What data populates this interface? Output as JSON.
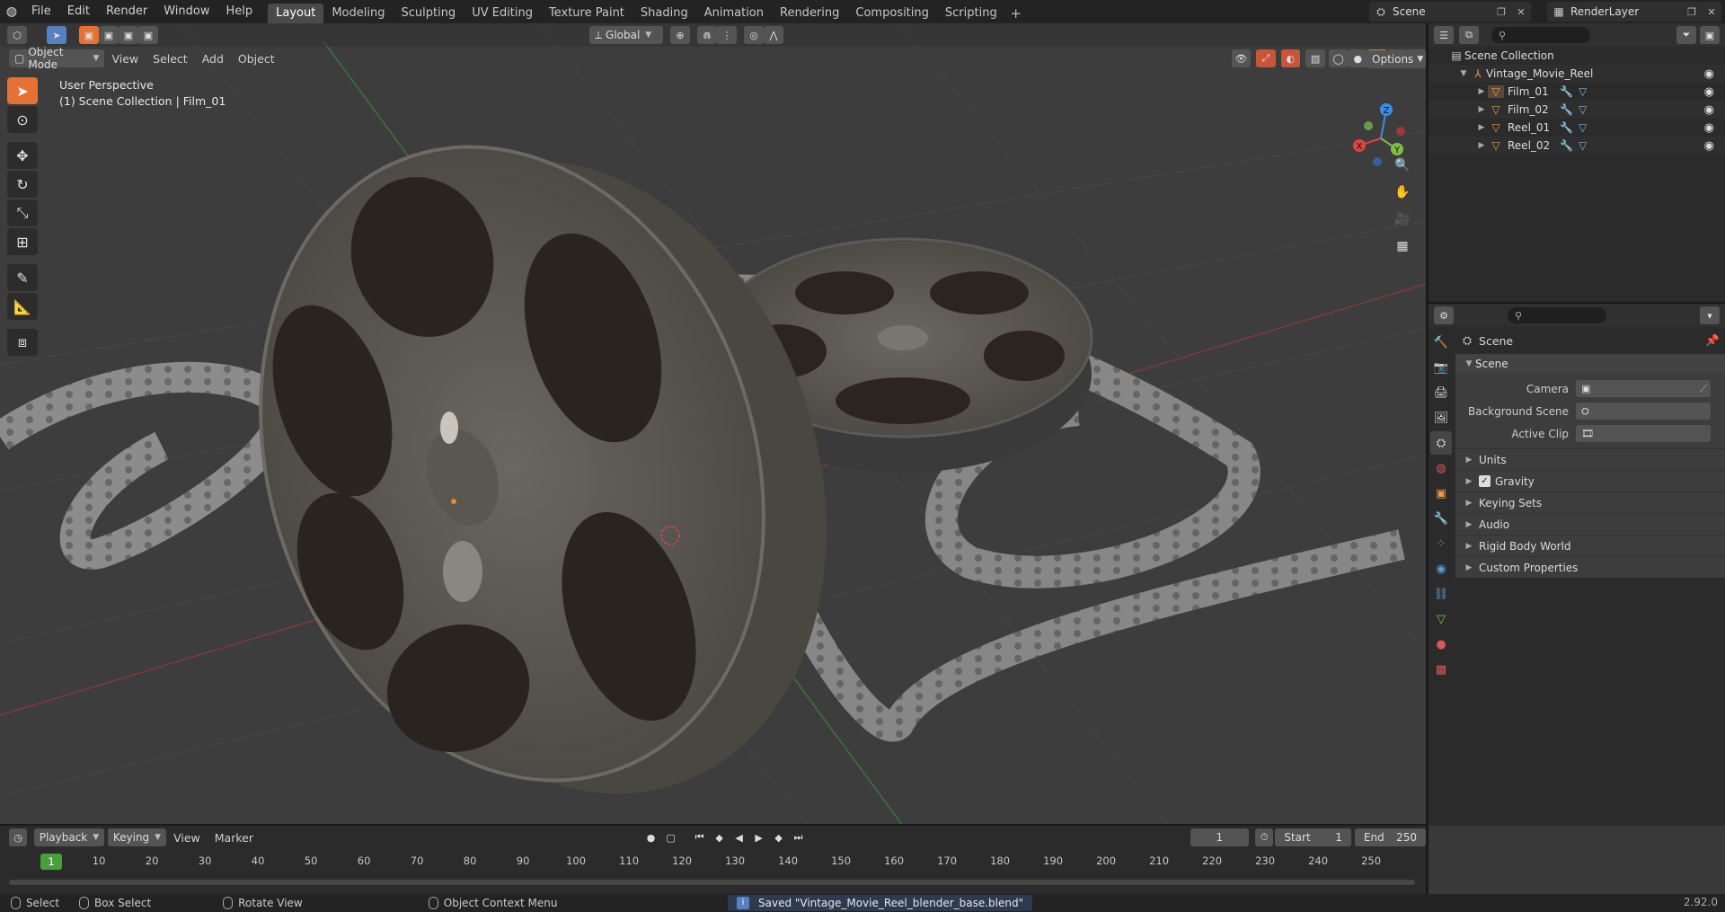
{
  "menubar": {
    "items": [
      "File",
      "Edit",
      "Render",
      "Window",
      "Help"
    ],
    "workspaces": [
      "Layout",
      "Modeling",
      "Sculpting",
      "UV Editing",
      "Texture Paint",
      "Shading",
      "Animation",
      "Rendering",
      "Compositing",
      "Scripting"
    ],
    "active_workspace": "Layout",
    "scene_name": "Scene",
    "view_layer": "RenderLayer"
  },
  "viewport": {
    "mode": "Object Mode",
    "menus": [
      "View",
      "Select",
      "Add",
      "Object"
    ],
    "transform_orientation": "Global",
    "options_label": "Options",
    "perspective_label": "User Perspective",
    "collection_label": "(1) Scene Collection | Film_01",
    "gizmo": {
      "x": "X",
      "y": "Y",
      "z": "Z"
    }
  },
  "outliner": {
    "root": "Scene Collection",
    "collection": "Vintage_Movie_Reel",
    "objects": [
      "Film_01",
      "Film_02",
      "Reel_01",
      "Reel_02"
    ]
  },
  "properties": {
    "title": "Scene",
    "panel": "Scene",
    "fields": [
      {
        "label": "Camera",
        "value": ""
      },
      {
        "label": "Background Scene",
        "value": ""
      },
      {
        "label": "Active Clip",
        "value": ""
      }
    ],
    "subpanels": [
      "Units",
      "Gravity",
      "Keying Sets",
      "Audio",
      "Rigid Body World",
      "Custom Properties"
    ],
    "gravity_checked": true
  },
  "timeline": {
    "menus": [
      "Playback",
      "Keying",
      "View",
      "Marker"
    ],
    "current_frame": "1",
    "start_label": "Start",
    "start": "1",
    "end_label": "End",
    "end": "250",
    "ticks": [
      "1",
      "10",
      "20",
      "30",
      "40",
      "50",
      "60",
      "70",
      "80",
      "90",
      "100",
      "110",
      "120",
      "130",
      "140",
      "150",
      "160",
      "170",
      "180",
      "190",
      "200",
      "210",
      "220",
      "230",
      "240",
      "250"
    ]
  },
  "statusbar": {
    "select": "Select",
    "box_select": "Box Select",
    "rotate_view": "Rotate View",
    "context_menu": "Object Context Menu",
    "message": "Saved \"Vintage_Movie_Reel_blender_base.blend\"",
    "version": "2.92.0"
  },
  "colors": {
    "accent": "#e57135",
    "selected_blue": "#5680c2",
    "frame_green": "#4a9e3e",
    "axis_x": "#e0443e",
    "axis_y": "#7bc043",
    "axis_z": "#3b8ee8"
  }
}
